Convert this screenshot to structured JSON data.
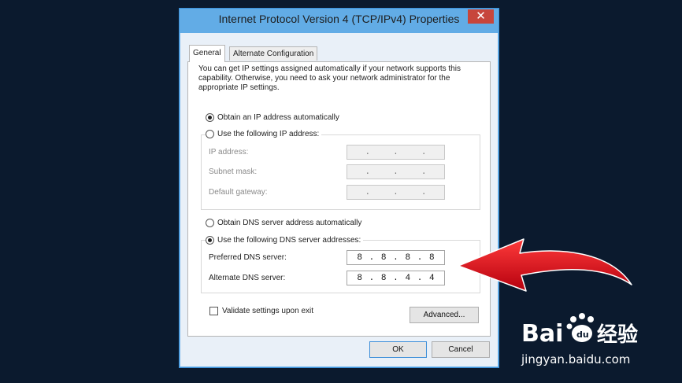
{
  "window": {
    "title": "Internet Protocol Version 4 (TCP/IPv4) Properties",
    "close_glyph": "✕"
  },
  "tabs": [
    {
      "label": "General",
      "active": true
    },
    {
      "label": "Alternate Configuration",
      "active": false
    }
  ],
  "description": "You can get IP settings assigned automatically if your network supports this capability. Otherwise, you need to ask your network administrator for the appropriate IP settings.",
  "ip_section": {
    "auto_label": "Obtain an IP address automatically",
    "auto_selected": true,
    "manual_label": "Use the following IP address:",
    "manual_selected": false,
    "fields": [
      {
        "label": "IP address:",
        "octets": [
          "",
          "",
          "",
          ""
        ],
        "enabled": false
      },
      {
        "label": "Subnet mask:",
        "octets": [
          "",
          "",
          "",
          ""
        ],
        "enabled": false
      },
      {
        "label": "Default gateway:",
        "octets": [
          "",
          "",
          "",
          ""
        ],
        "enabled": false
      }
    ]
  },
  "dns_section": {
    "auto_label": "Obtain DNS server address automatically",
    "auto_selected": false,
    "manual_label": "Use the following DNS server addresses:",
    "manual_selected": true,
    "fields": [
      {
        "label": "Preferred DNS server:",
        "octets": [
          "8",
          "8",
          "8",
          "8"
        ],
        "enabled": true
      },
      {
        "label": "Alternate DNS server:",
        "octets": [
          "8",
          "8",
          "4",
          "4"
        ],
        "enabled": true
      }
    ]
  },
  "validate": {
    "label": "Validate settings upon exit",
    "checked": false
  },
  "buttons": {
    "advanced": "Advanced...",
    "ok": "OK",
    "cancel": "Cancel"
  },
  "watermark": {
    "logo_text": "Bai du 经验",
    "url": "jingyan.baidu.com"
  },
  "colors": {
    "background": "#0b1a2e",
    "titlebar": "#62ace6",
    "arrow": "#d8101c",
    "close": "#c7463c"
  }
}
